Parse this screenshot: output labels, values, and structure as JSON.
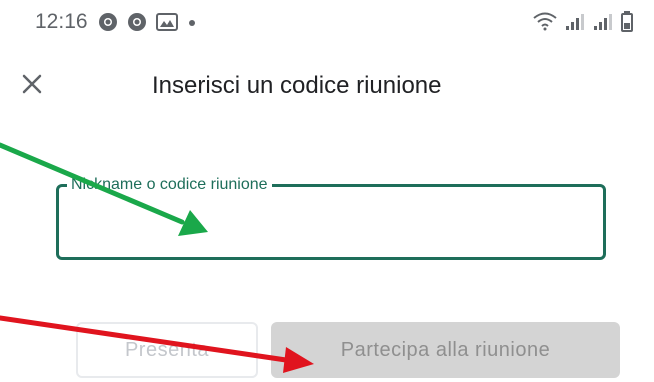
{
  "status_bar": {
    "time": "12:16",
    "notification_icons": [
      "chrome-icon",
      "chrome-icon",
      "gallery-icon",
      "dot-icon"
    ],
    "system_icons": [
      "wifi-icon",
      "signal-icon",
      "signal-icon",
      "battery-icon"
    ]
  },
  "header": {
    "title": "Inserisci un codice riunione"
  },
  "form": {
    "field_label": "Nickname o codice riunione",
    "field_value": ""
  },
  "actions": {
    "present_label": "Presenta",
    "join_label": "Partecipa alla riunione"
  },
  "colors": {
    "accent": "#1e6e5a",
    "annotation_green": "#1aa84a",
    "annotation_red": "#e0141e",
    "disabled_button": "#d4d4d4"
  }
}
